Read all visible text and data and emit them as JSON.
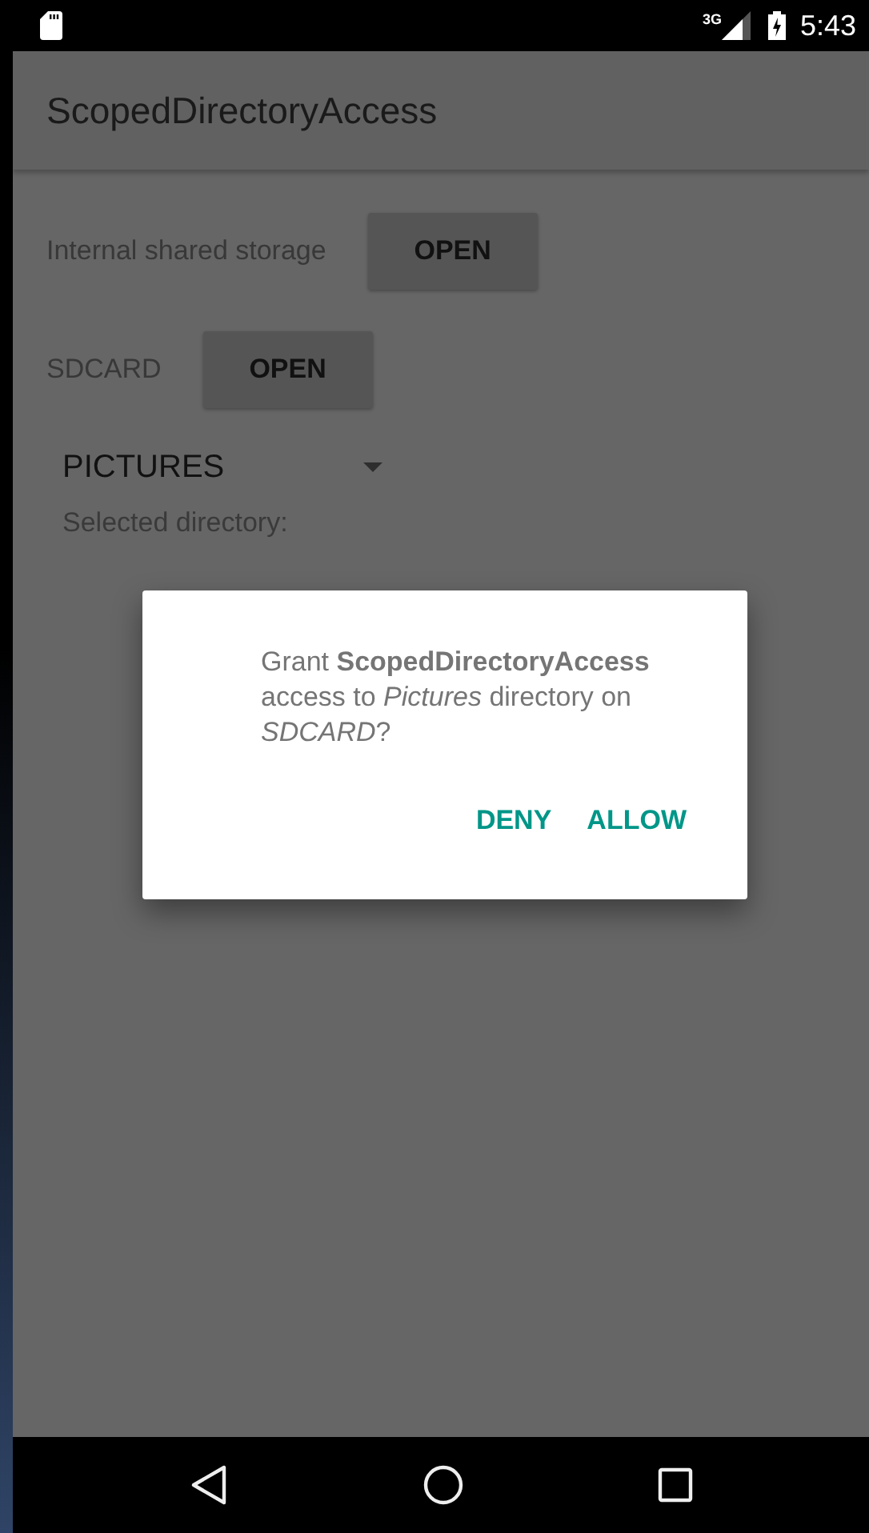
{
  "status_bar": {
    "network": "3G",
    "time": "5:43"
  },
  "app_bar": {
    "title": "ScopedDirectoryAccess"
  },
  "storage_rows": [
    {
      "label": "Internal shared storage",
      "button": "OPEN"
    },
    {
      "label": "SDCARD",
      "button": "OPEN"
    }
  ],
  "directory_spinner": {
    "value": "PICTURES"
  },
  "selected_directory_label": "Selected directory:",
  "dialog": {
    "message": "Grant **ScopedDirectoryAccess** access to *Pictures* directory on *SDCARD*?",
    "buttons": [
      "DENY",
      "ALLOW"
    ]
  }
}
